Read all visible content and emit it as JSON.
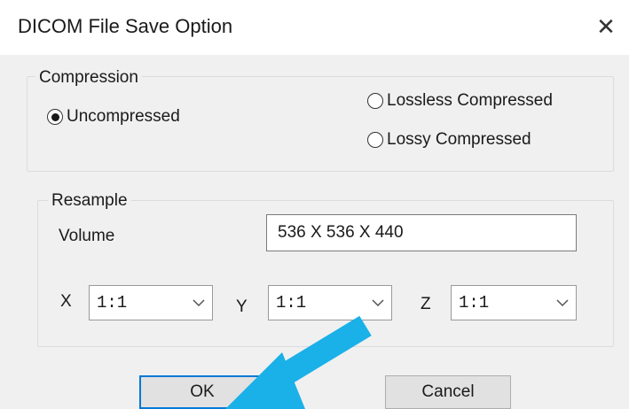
{
  "window": {
    "title": "DICOM File Save Option",
    "close_glyph": "✕"
  },
  "compression": {
    "legend": "Compression",
    "options": [
      {
        "label": "Uncompressed",
        "selected": true
      },
      {
        "label": "Lossless Compressed",
        "selected": false
      },
      {
        "label": "Lossy Compressed",
        "selected": false
      }
    ]
  },
  "resample": {
    "legend": "Resample",
    "volume_label": "Volume",
    "volume_value": "536 X 536 X 440",
    "x_label": "X",
    "y_label": "Y",
    "z_label": "Z",
    "x_value": "1:1",
    "y_value": "1:1",
    "z_value": "1:1"
  },
  "buttons": {
    "ok_label": "OK",
    "cancel_label": "Cancel"
  },
  "colors": {
    "arrow": "#1ab0e8",
    "focus_border": "#0078d7",
    "dialog_background": "#f0f0f0"
  },
  "icons": {
    "close": "close-icon",
    "dropdown": "chevron-down-icon",
    "annotation": "pointer-arrow-icon"
  }
}
